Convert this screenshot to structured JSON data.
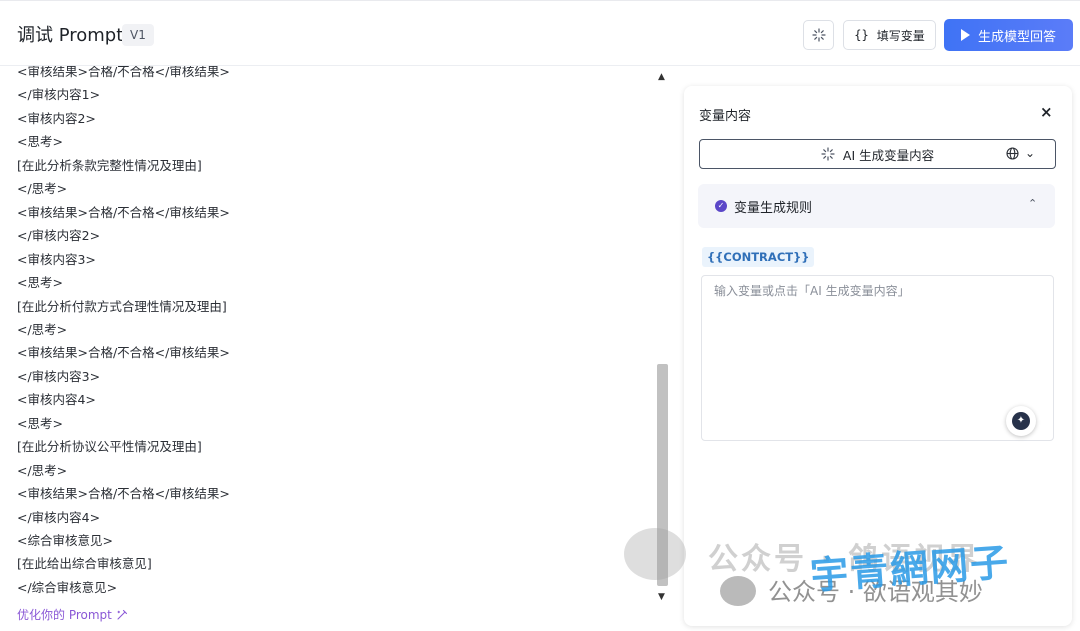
{
  "header": {
    "title": "调试 Prompt",
    "version": "V1",
    "magic_icon": "sparkle-icon",
    "fill_vars_icon": "{}",
    "fill_vars_label": "填写变量",
    "generate_label": "生成模型回答"
  },
  "editor": {
    "lines": [
      "<审核结果>合格/不合格</审核结果>",
      "</审核内容1>",
      "<审核内容2>",
      "<思考>",
      "[在此分析条款完整性情况及理由]",
      "</思考>",
      "<审核结果>合格/不合格</审核结果>",
      "</审核内容2>",
      "<审核内容3>",
      "<思考>",
      "[在此分析付款方式合理性情况及理由]",
      "</思考>",
      "<审核结果>合格/不合格</审核结果>",
      "</审核内容3>",
      "<审核内容4>",
      "<思考>",
      "[在此分析协议公平性情况及理由]",
      "</思考>",
      "<审核结果>合格/不合格</审核结果>",
      "</审核内容4>",
      "<综合审核意见>",
      "[在此给出综合审核意见]",
      "</综合审核意见>"
    ],
    "optimize_label": "优化你的 Prompt"
  },
  "variable_panel": {
    "title": "变量内容",
    "close": "×",
    "ai_generate_label": "AI 生成变量内容",
    "rules_label": "变量生成规则",
    "variable_name": "{{CONTRACT}}",
    "placeholder": "输入变量或点击「AI 生成变量内容」"
  },
  "watermark": {
    "primary": "公众号 · 鸽语视界",
    "secondary": "公众号 · 欲语观其妙",
    "overlay": "宇青網网子"
  },
  "colors": {
    "accent": "#4a76f6",
    "link_purple": "#8a58d6",
    "tag_blue": "#2f6fb8"
  }
}
